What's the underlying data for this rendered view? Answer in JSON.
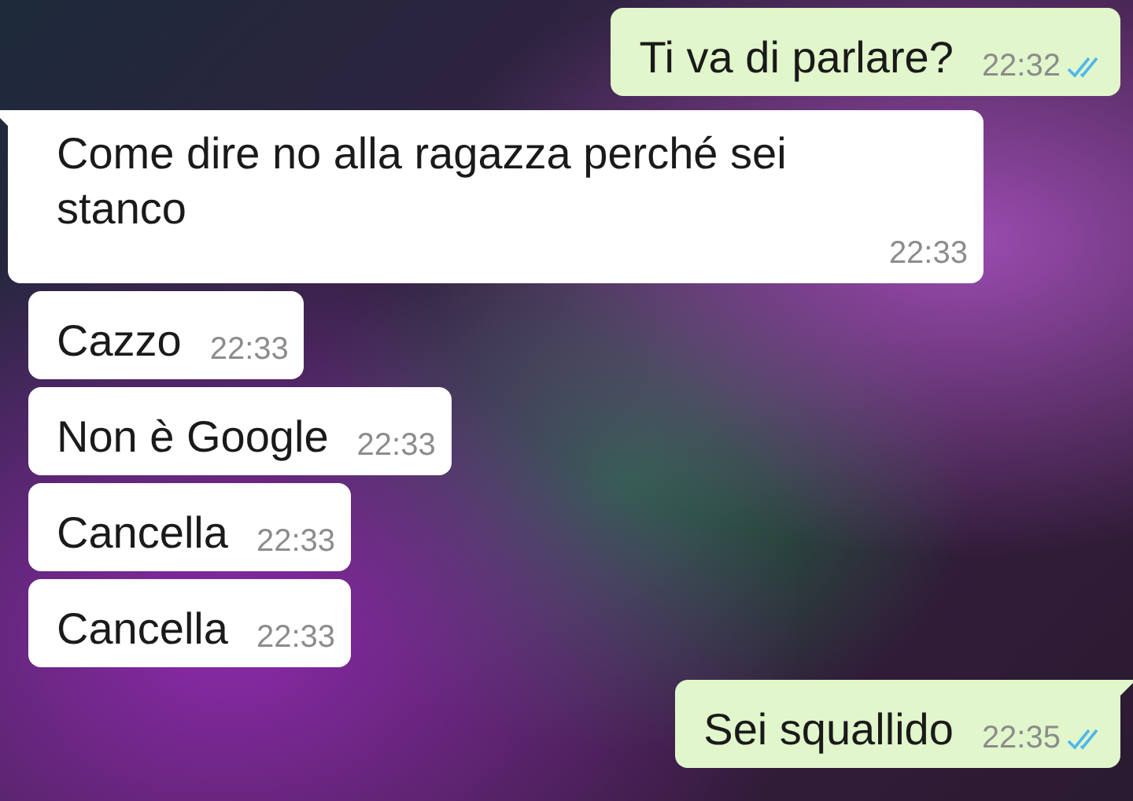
{
  "messages": [
    {
      "kind": "sent",
      "text": "Ti va di parlare?",
      "time": "22:32",
      "read": true,
      "tail": false
    },
    {
      "kind": "received",
      "text": "Come dire no alla ragazza perché sei stanco",
      "time": "22:33",
      "tail": true
    },
    {
      "kind": "received",
      "text": "Cazzo",
      "time": "22:33",
      "tail": false
    },
    {
      "kind": "received",
      "text": "Non è Google",
      "time": "22:33",
      "tail": false
    },
    {
      "kind": "received",
      "text": "Cancella",
      "time": "22:33",
      "tail": false
    },
    {
      "kind": "received",
      "text": "Cancella",
      "time": "22:33",
      "tail": false
    },
    {
      "kind": "sent",
      "text": "Sei squallido",
      "time": "22:35",
      "read": true,
      "tail": true
    }
  ]
}
